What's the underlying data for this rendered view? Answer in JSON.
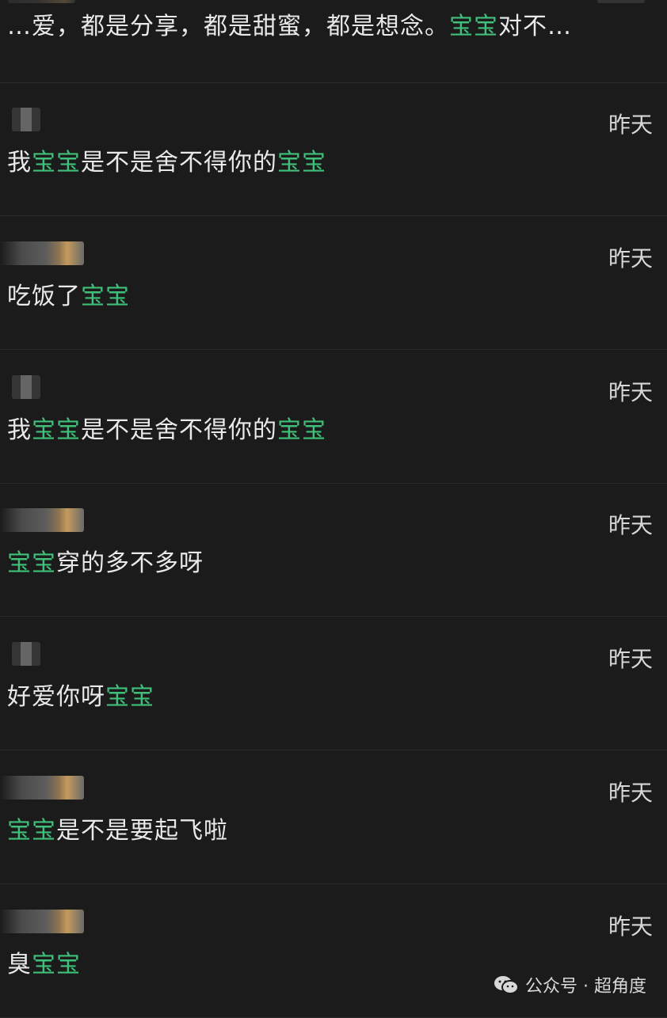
{
  "highlight_color": "#3fbf79",
  "top_message": {
    "parts": [
      {
        "text": "…爱，都是分享，都是甜蜜，都是想念。",
        "hl": false
      },
      {
        "text": "宝宝",
        "hl": true
      },
      {
        "text": "对不…",
        "hl": false
      }
    ]
  },
  "messages": [
    {
      "avatar": "small",
      "time": "昨天",
      "parts": [
        {
          "text": "我",
          "hl": false
        },
        {
          "text": "宝宝",
          "hl": true
        },
        {
          "text": "是不是舍不得你的",
          "hl": false
        },
        {
          "text": "宝宝",
          "hl": true
        }
      ]
    },
    {
      "avatar": "wide",
      "time": "昨天",
      "parts": [
        {
          "text": "吃饭了",
          "hl": false
        },
        {
          "text": "宝宝",
          "hl": true
        }
      ]
    },
    {
      "avatar": "small",
      "time": "昨天",
      "parts": [
        {
          "text": "我",
          "hl": false
        },
        {
          "text": "宝宝",
          "hl": true
        },
        {
          "text": "是不是舍不得你的",
          "hl": false
        },
        {
          "text": "宝宝",
          "hl": true
        }
      ]
    },
    {
      "avatar": "wide",
      "time": "昨天",
      "parts": [
        {
          "text": "宝宝",
          "hl": true
        },
        {
          "text": "穿的多不多呀",
          "hl": false
        }
      ]
    },
    {
      "avatar": "small",
      "time": "昨天",
      "parts": [
        {
          "text": "好爱你呀",
          "hl": false
        },
        {
          "text": "宝宝",
          "hl": true
        }
      ]
    },
    {
      "avatar": "wide",
      "time": "昨天",
      "parts": [
        {
          "text": "宝宝",
          "hl": true
        },
        {
          "text": "是不是要起飞啦",
          "hl": false
        }
      ]
    },
    {
      "avatar": "wide",
      "time": "昨天",
      "parts": [
        {
          "text": "臭",
          "hl": false
        },
        {
          "text": "宝宝",
          "hl": true
        }
      ]
    }
  ],
  "watermark": {
    "icon": "wechat-icon",
    "text": "公众号 · 超角度"
  }
}
